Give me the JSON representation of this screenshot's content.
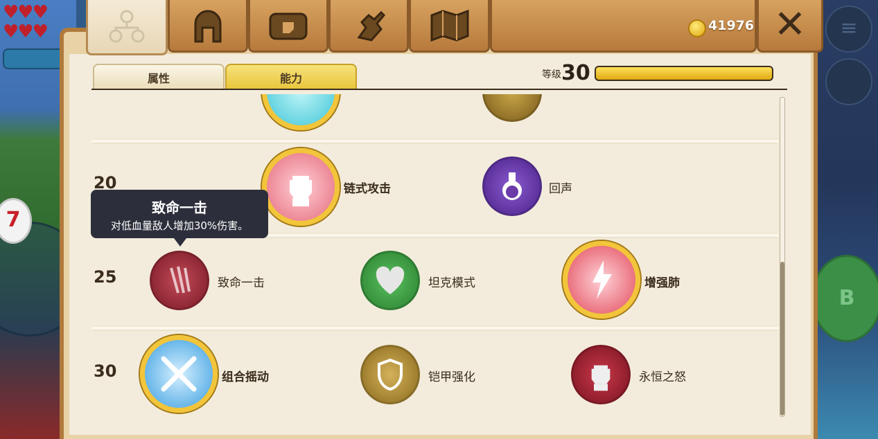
{
  "nav": {
    "tabs": [
      {
        "icon": "skill-tree-icon",
        "active": true
      },
      {
        "icon": "helmet-icon",
        "active": false
      },
      {
        "icon": "chest-icon",
        "active": false
      },
      {
        "icon": "gauntlet-icon",
        "active": false
      },
      {
        "icon": "map-icon",
        "active": false
      }
    ],
    "coins": "41976",
    "close_label": "✕"
  },
  "subtabs": {
    "attributes": "属性",
    "abilities": "能力",
    "active": "abilities"
  },
  "level": {
    "label": "等级",
    "value": "30",
    "xp_progress": 1.0
  },
  "rows": [
    {
      "level": "",
      "abilities": [
        {
          "name": "",
          "icon": "ring-icon",
          "color": "#3fc6d6",
          "selected": true
        },
        {
          "name": "",
          "icon": "shield-icon",
          "color": "#9a7a2a",
          "selected": false
        }
      ]
    },
    {
      "level": "20",
      "abilities": [
        {
          "name": "链式攻击",
          "icon": "fist-icon",
          "color": "#e56a7c",
          "selected": true
        },
        {
          "name": "回声",
          "icon": "potion-icon",
          "color": "#6a3aa8",
          "selected": false
        }
      ]
    },
    {
      "level": "25",
      "abilities": [
        {
          "name": "致命一击",
          "icon": "claw-icon",
          "color": "#9a2a36",
          "selected": false
        },
        {
          "name": "坦克模式",
          "icon": "heart-icon",
          "color": "#3da342",
          "selected": false
        },
        {
          "name": "增强肺",
          "icon": "lightning-icon",
          "color": "#e14a5a",
          "selected": true
        }
      ]
    },
    {
      "level": "30",
      "abilities": [
        {
          "name": "组合摇动",
          "icon": "crossed-swords-icon",
          "color": "#3a9ee0",
          "selected": true
        },
        {
          "name": "铠甲强化",
          "icon": "shield-icon",
          "color": "#a98a30",
          "selected": false
        },
        {
          "name": "永恒之怒",
          "icon": "fist-icon",
          "color": "#a3202f",
          "selected": false
        }
      ]
    }
  ],
  "tooltip": {
    "title": "致命一击",
    "description": "对低血量敌人增加30%伤害。"
  },
  "hud": {
    "right_button": "B",
    "left_badge": "7"
  }
}
